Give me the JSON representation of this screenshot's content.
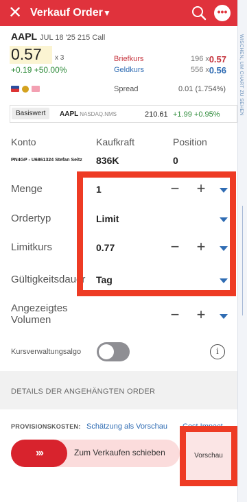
{
  "header": {
    "title": "Verkauf Order",
    "close_icon": "close-icon",
    "search_icon": "search-icon",
    "more_icon": "more-icon"
  },
  "side_panel": {
    "label": "WISCHEN, UM CHART ZU SEHEN"
  },
  "instrument": {
    "symbol": "AAPL",
    "contract": "JUL 18 '25 215 Call",
    "last_price": "0.57",
    "last_qty": "x 3",
    "change": "+0.19 +50.00%"
  },
  "quotes": {
    "bid_label": "Briefkurs",
    "bid_size": "196 x",
    "bid_price": "0.57",
    "ask_label": "Geldkurs",
    "ask_size": "556 x",
    "ask_price": "0.56",
    "spread_label": "Spread",
    "spread_value": "0.01 (1.754%)"
  },
  "underlying": {
    "tag": "Basiswert",
    "symbol": "AAPL",
    "exchange": "NASDAQ.NMS",
    "price": "210.61",
    "change": "+1.99 +0.95%"
  },
  "account": {
    "konto_label": "Konto",
    "kaufkraft_label": "Kaufkraft",
    "position_label": "Position",
    "konto_value": "PN4GP - U6861324 Stefan Seitz",
    "kaufkraft_value": "836K",
    "position_value": "0"
  },
  "order": {
    "menge_label": "Menge",
    "menge_value": "1",
    "ordertyp_label": "Ordertyp",
    "ordertyp_value": "Limit",
    "limitkurs_label": "Limitkurs",
    "limitkurs_value": "0.77",
    "gueltigkeit_label": "Gültigkeitsdauer",
    "gueltigkeit_value": "Tag",
    "angezeigt_label_1": "Angezeigtes",
    "angezeigt_label_2": "Volumen",
    "algo_label": "Kursverwaltungsalgo",
    "minus": "−",
    "plus": "+"
  },
  "attached": {
    "title": "DETAILS DER ANGEHÄNGTEN ORDER"
  },
  "footer": {
    "provision_label": "PROVISIONSKOSTEN:",
    "provision_link": "Schätzung als Vorschau",
    "provision_link2": "Cost Impact",
    "swipe_label": "Zum Verkaufen schieben",
    "swipe_arrows": "›››",
    "preview_label": "Vorschau"
  },
  "colors": {
    "header": "#e0323c",
    "accent_blue": "#2f6cb3",
    "positive": "#2e8b3a",
    "highlight": "#ee3b24"
  }
}
